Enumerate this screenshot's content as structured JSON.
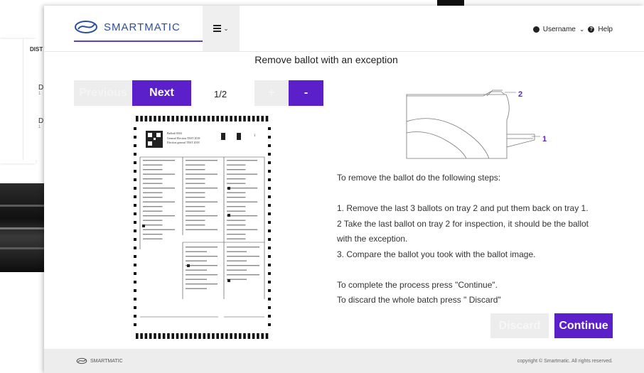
{
  "background": {
    "column_header": "DIST",
    "items": [
      {
        "letter": "D",
        "sub": "1"
      },
      {
        "letter": "D",
        "sub": "1"
      }
    ]
  },
  "header": {
    "logo_text": "SMARTMATIC",
    "menu_icon": "hamburger-icon",
    "username": "Username",
    "help": "Help"
  },
  "dialog": {
    "title": "Remove ballot with an exception"
  },
  "pager": {
    "previous_label": "Previous",
    "next_label": "Next",
    "page": "1/2",
    "zoom_in_label": "+",
    "zoom_out_label": "-"
  },
  "ballot": {
    "header_text": [
      "Ballot# 0504",
      "General Election TEST 2018",
      "Election general TEST 2018"
    ]
  },
  "printer_diagram": {
    "tray_top_label": "2",
    "tray_bottom_label": "1"
  },
  "instructions": [
    "To remove the ballot do the following steps:",
    "",
    "1. Remove the last 3 ballots on tray 2 and put them back on tray 1.",
    "2 Take the last ballot on tray 2 for inspection, it should be the ballot",
    "with the exception.",
    "3. Compare the ballot you took with the ballot image.",
    "",
    "To complete the process press \"Continue\".",
    "To discard the whole batch press \" Discard\""
  ],
  "actions": {
    "discard_label": "Discard",
    "continue_label": "Continue"
  },
  "footer": {
    "logo_text": "SMARTMATIC",
    "copyright": "copyright © Smartmatic. All rights reserved."
  },
  "colors": {
    "accent": "#5b20c9",
    "disabled": "#ededed",
    "brand_blue": "#2b4fa0"
  }
}
